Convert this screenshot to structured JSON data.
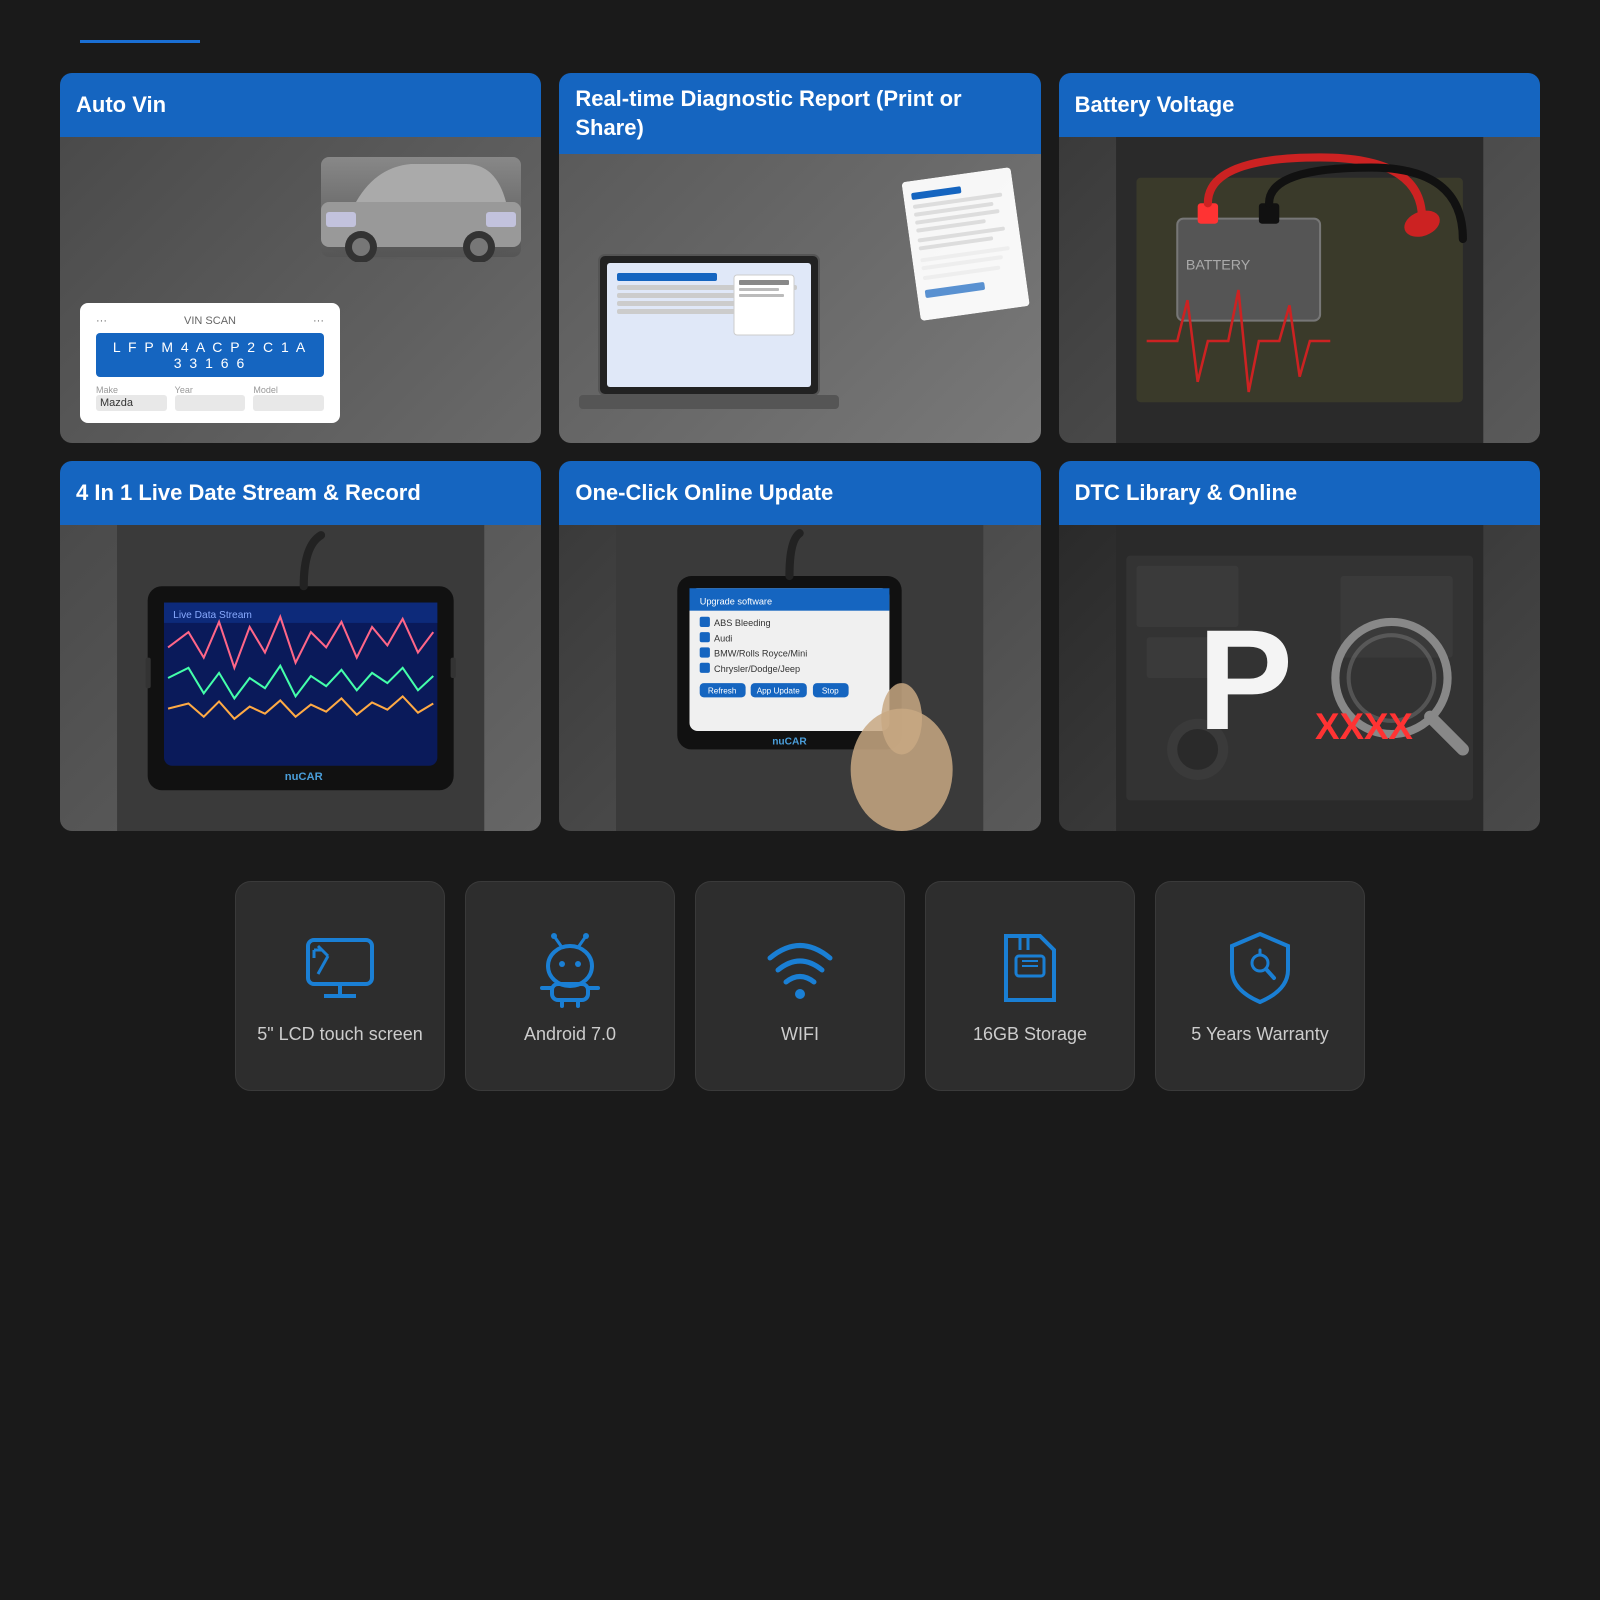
{
  "topLine": {},
  "features": {
    "cards": [
      {
        "id": "auto-vin",
        "label": "Auto Vin",
        "vin": {
          "title": "VIN SCAN",
          "number": "L F P M 4 A C P 2 C 1 A 3 3 1 6 6",
          "makeLabel": "Make",
          "makeValue": "Mazda",
          "yearLabel": "Year",
          "yearValue": "",
          "modelLabel": "Model",
          "modelValue": ""
        }
      },
      {
        "id": "diagnostic-report",
        "label": "Real-time Diagnostic Report (Print or Share)"
      },
      {
        "id": "battery-voltage",
        "label": "Battery Voltage"
      },
      {
        "id": "live-stream",
        "label": "4 In 1 Live Date Stream & Record"
      },
      {
        "id": "online-update",
        "label": "One-Click Online Update",
        "updateItems": [
          "ABS Bleeding",
          "Audi",
          "BMW/Rolls Royce/Mini",
          "Chrysler/Dodge/Jeep"
        ]
      },
      {
        "id": "dtc-library",
        "label": "DTC Library & Online",
        "dtcCode": "P",
        "xxxx": "XXXX"
      }
    ]
  },
  "bottomFeatures": [
    {
      "id": "lcd-screen",
      "icon": "screen-icon",
      "label": "5\" LCD touch screen"
    },
    {
      "id": "android",
      "icon": "android-icon",
      "label": "Android 7.0"
    },
    {
      "id": "wifi",
      "icon": "wifi-icon",
      "label": "WIFI"
    },
    {
      "id": "storage",
      "icon": "storage-icon",
      "label": "16GB Storage"
    },
    {
      "id": "warranty",
      "icon": "warranty-icon",
      "label": "5 Years Warranty"
    }
  ]
}
